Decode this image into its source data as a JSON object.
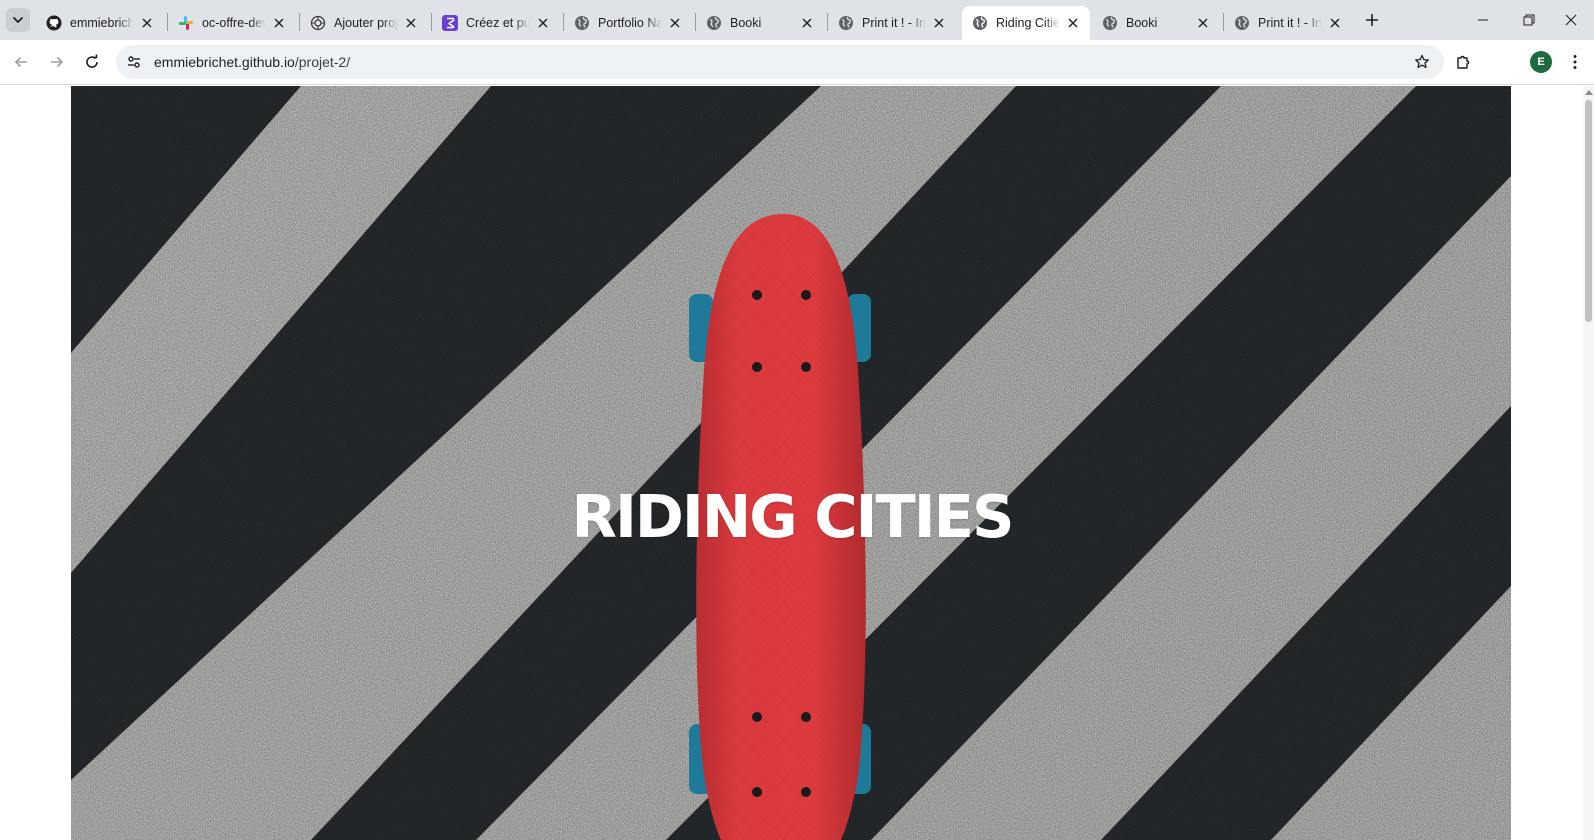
{
  "browser": {
    "tabs": [
      {
        "title": "emmiebrichet",
        "icon": "github-icon"
      },
      {
        "title": "oc-offre-dev",
        "icon": "slack-icon"
      },
      {
        "title": "Ajouter projet",
        "icon": "openai-icon"
      },
      {
        "title": "Créez et publiez",
        "icon": "framer-icon"
      },
      {
        "title": "Portfolio Nathalie",
        "icon": "globe-icon"
      },
      {
        "title": "Booki",
        "icon": "globe-icon"
      },
      {
        "title": "Print it ! - Imprimerie",
        "icon": "globe-icon"
      },
      {
        "title": "Riding Cities",
        "icon": "globe-icon",
        "active": true
      },
      {
        "title": "Booki",
        "icon": "globe-icon"
      },
      {
        "title": "Print it ! - Imprimerie",
        "icon": "globe-icon"
      }
    ],
    "url_host": "emmiebrichet.github.io",
    "url_path": "/projet-2/",
    "profile_initial": "E"
  },
  "page": {
    "hero_title": "RIDING CITIES",
    "hero_image": "skateboard-on-crosswalk-image"
  },
  "colors": {
    "tabstrip": "#dfe3e8",
    "asphalt": "#2b3033",
    "stripe": "#c8c8c6",
    "skateboard": "#d8373a",
    "wheels": "#1f7a9a"
  }
}
